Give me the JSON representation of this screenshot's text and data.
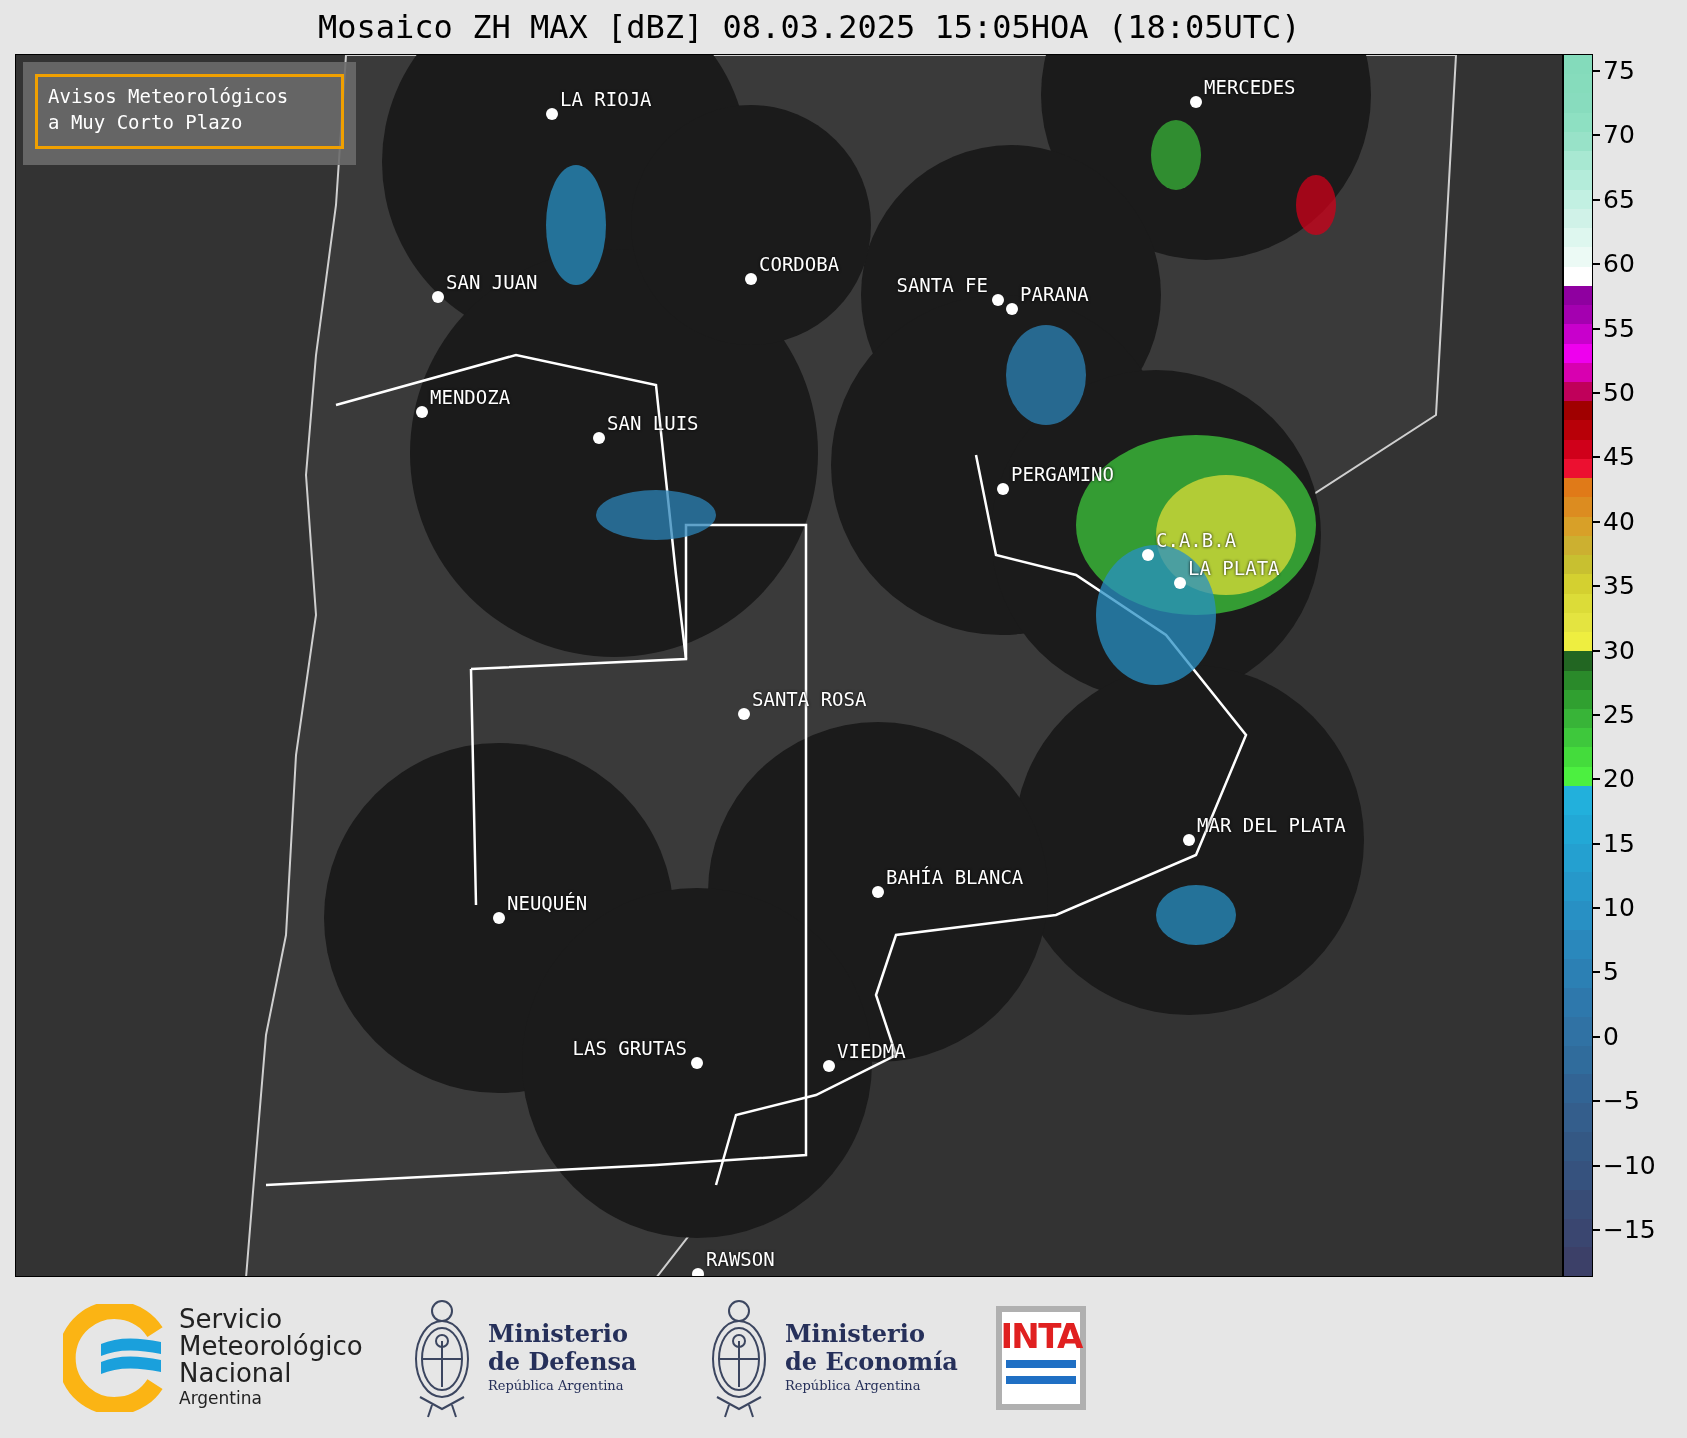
{
  "title": "Mosaico ZH MAX [dBZ] 08.03.2025 15:05HOA (18:05UTC)",
  "notice": {
    "lines": [
      "Avisos Meteorológicos",
      "a Muy Corto Plazo"
    ]
  },
  "cities": [
    {
      "name": "LA RIOJA"
    },
    {
      "name": "MERCEDES"
    },
    {
      "name": "CORDOBA"
    },
    {
      "name": "SAN JUAN"
    },
    {
      "name": "SANTA FE"
    },
    {
      "name": "PARANA"
    },
    {
      "name": "MENDOZA"
    },
    {
      "name": "SAN LUIS"
    },
    {
      "name": "PERGAMINO"
    },
    {
      "name": "C.A.B.A"
    },
    {
      "name": "LA PLATA"
    },
    {
      "name": "SANTA ROSA"
    },
    {
      "name": "MAR DEL PLATA"
    },
    {
      "name": "BAHÍA BLANCA"
    },
    {
      "name": "NEUQUÉN"
    },
    {
      "name": "LAS GRUTAS"
    },
    {
      "name": "VIEDMA"
    },
    {
      "name": "RAWSON"
    }
  ],
  "colorbar": {
    "ticks": [
      "75",
      "70",
      "65",
      "60",
      "55",
      "50",
      "45",
      "40",
      "35",
      "30",
      "25",
      "20",
      "15",
      "10",
      "5",
      "0",
      "−5",
      "−10",
      "−15"
    ],
    "segments": [
      {
        "color": "#84dbbb"
      },
      {
        "color": "#86dcbc"
      },
      {
        "color": "#88dcbe"
      },
      {
        "color": "#8ee0c2"
      },
      {
        "color": "#98e2c8"
      },
      {
        "color": "#a8e8d2"
      },
      {
        "color": "#b4ecda"
      },
      {
        "color": "#c2f0e2"
      },
      {
        "color": "#d0f2e8"
      },
      {
        "color": "#def7ef"
      },
      {
        "color": "#ecfaf5"
      },
      {
        "color": "#ffffff"
      },
      {
        "color": "#8f00a0"
      },
      {
        "color": "#a400b0"
      },
      {
        "color": "#c800cc"
      },
      {
        "color": "#ee00ee"
      },
      {
        "color": "#d800b0"
      },
      {
        "color": "#c0005a"
      },
      {
        "color": "#a00000"
      },
      {
        "color": "#b80008"
      },
      {
        "color": "#d0001a"
      },
      {
        "color": "#ec1030"
      },
      {
        "color": "#e07a18"
      },
      {
        "color": "#dc8c20"
      },
      {
        "color": "#d8a028"
      },
      {
        "color": "#ccb030"
      },
      {
        "color": "#c8c030"
      },
      {
        "color": "#d4d030"
      },
      {
        "color": "#dcdc38"
      },
      {
        "color": "#e4e440"
      },
      {
        "color": "#eeee40"
      },
      {
        "color": "#226622"
      },
      {
        "color": "#2a8a2a"
      },
      {
        "color": "#30a030"
      },
      {
        "color": "#38b438"
      },
      {
        "color": "#3ec83c"
      },
      {
        "color": "#44dc3c"
      },
      {
        "color": "#4cf040"
      },
      {
        "color": "#22b0dc"
      },
      {
        "color": "#22a8d6"
      },
      {
        "color": "#24a0d0"
      },
      {
        "color": "#2698ca"
      },
      {
        "color": "#2890c4"
      },
      {
        "color": "#2a88bc"
      },
      {
        "color": "#2c80b4"
      },
      {
        "color": "#2e78ac"
      },
      {
        "color": "#3072a4"
      },
      {
        "color": "#306c9c"
      },
      {
        "color": "#326494"
      },
      {
        "color": "#345e8c"
      },
      {
        "color": "#345884"
      },
      {
        "color": "#36527e"
      },
      {
        "color": "#384c76"
      },
      {
        "color": "#3a4670"
      },
      {
        "color": "#3c4068"
      }
    ]
  },
  "footer": {
    "logos": [
      {
        "kind": "smn",
        "lines": [
          "Servicio",
          "Meteorológico",
          "Nacional",
          "Argentina"
        ]
      },
      {
        "kind": "ministry",
        "lines": [
          "Ministerio",
          "de Defensa",
          "República Argentina"
        ]
      },
      {
        "kind": "ministry",
        "lines": [
          "Ministerio",
          "de Economía",
          "República Argentina"
        ]
      },
      {
        "kind": "inta",
        "lines": [
          "INTA"
        ]
      }
    ]
  }
}
